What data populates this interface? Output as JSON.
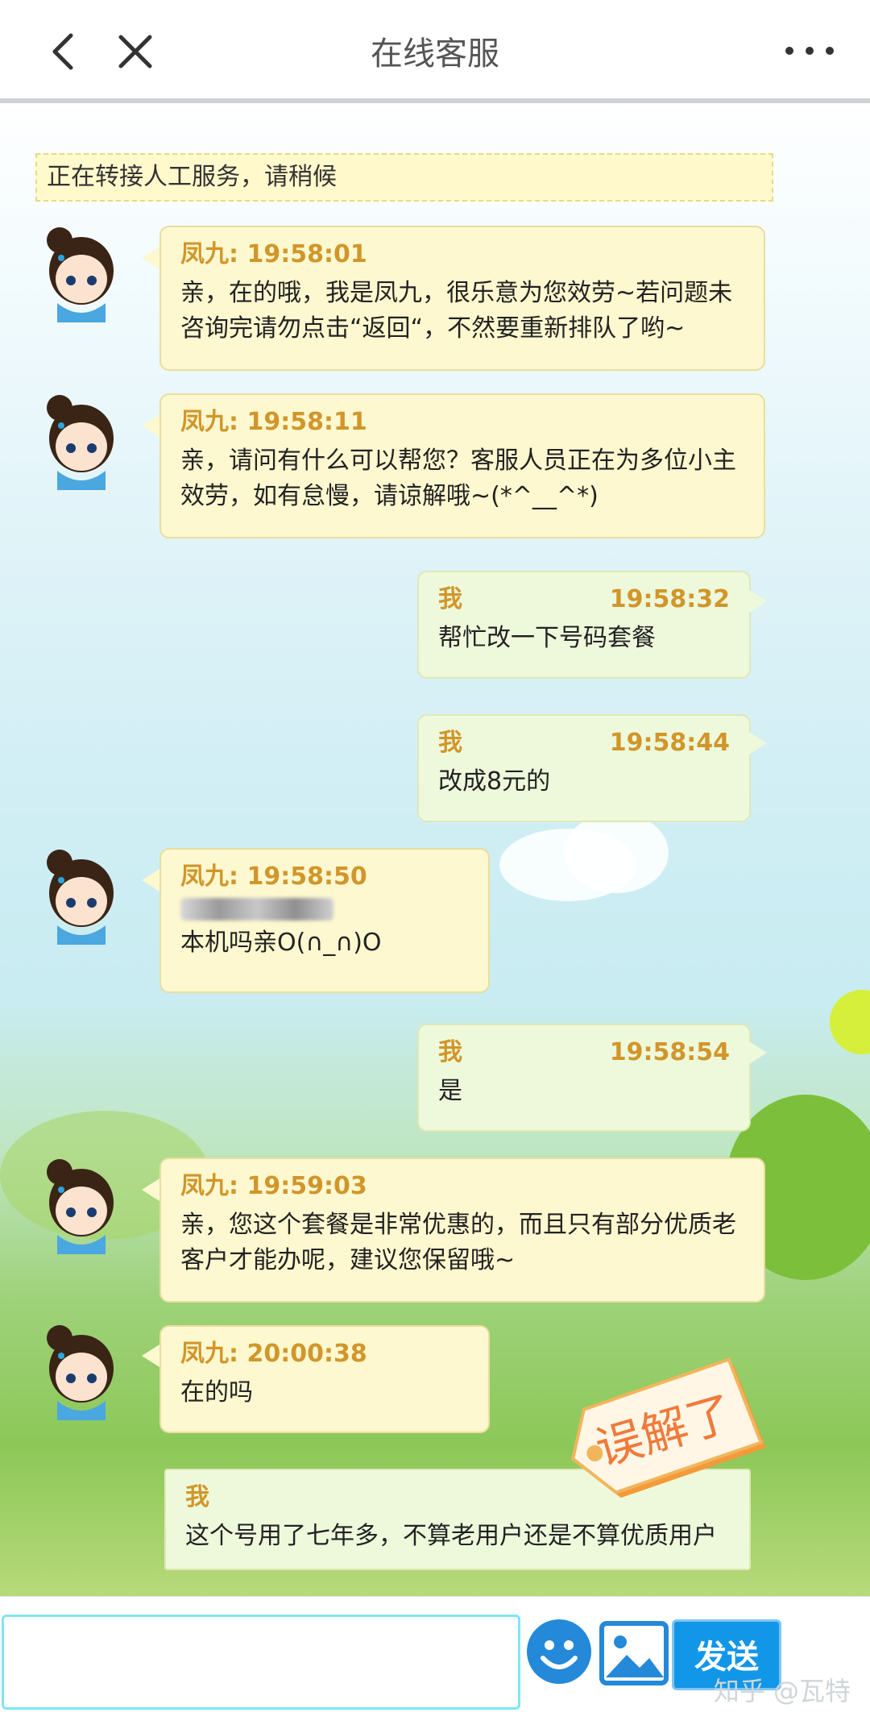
{
  "header": {
    "title": "在线客服"
  },
  "notice": "正在转接人工服务，请稍候",
  "messages": [
    {
      "side": "left",
      "sender": "凤九",
      "time": "19:58:01",
      "text": "亲，在的哦，我是凤九，很乐意为您效劳~若问题未咨询完请勿点击“返回“，不然要重新排队了哟~"
    },
    {
      "side": "left",
      "sender": "凤九",
      "time": "19:58:11",
      "text": "亲，请问有什么可以帮您？客服人员正在为多位小主效劳，如有怠慢，请谅解哦~(*^__^*)"
    },
    {
      "side": "right",
      "sender": "我",
      "time": "19:58:32",
      "text": "帮忙改一下号码套餐"
    },
    {
      "side": "right",
      "sender": "我",
      "time": "19:58:44",
      "text": "改成8元的"
    },
    {
      "side": "left",
      "sender": "凤九",
      "time": "19:58:50",
      "text": "本机吗亲O(∩_∩)O"
    },
    {
      "side": "right",
      "sender": "我",
      "time": "19:58:54",
      "text": "是"
    },
    {
      "side": "left",
      "sender": "凤九",
      "time": "19:59:03",
      "text": "亲，您这个套餐是非常优惠的，而且只有部分优质老客户才能办呢，建议您保留哦~"
    },
    {
      "side": "left",
      "sender": "凤九",
      "time": "20:00:38",
      "text": "在的吗"
    },
    {
      "side": "right",
      "sender": "我",
      "time": "",
      "text": "这个号用了七年多，不算老用户还是不算优质用户"
    }
  ],
  "sticker": {
    "text": "误解了"
  },
  "footer": {
    "send_label": "发送",
    "watermark": "知乎 @瓦特"
  },
  "colors": {
    "accent": "#1296e8",
    "name_color": "#d1962a"
  }
}
